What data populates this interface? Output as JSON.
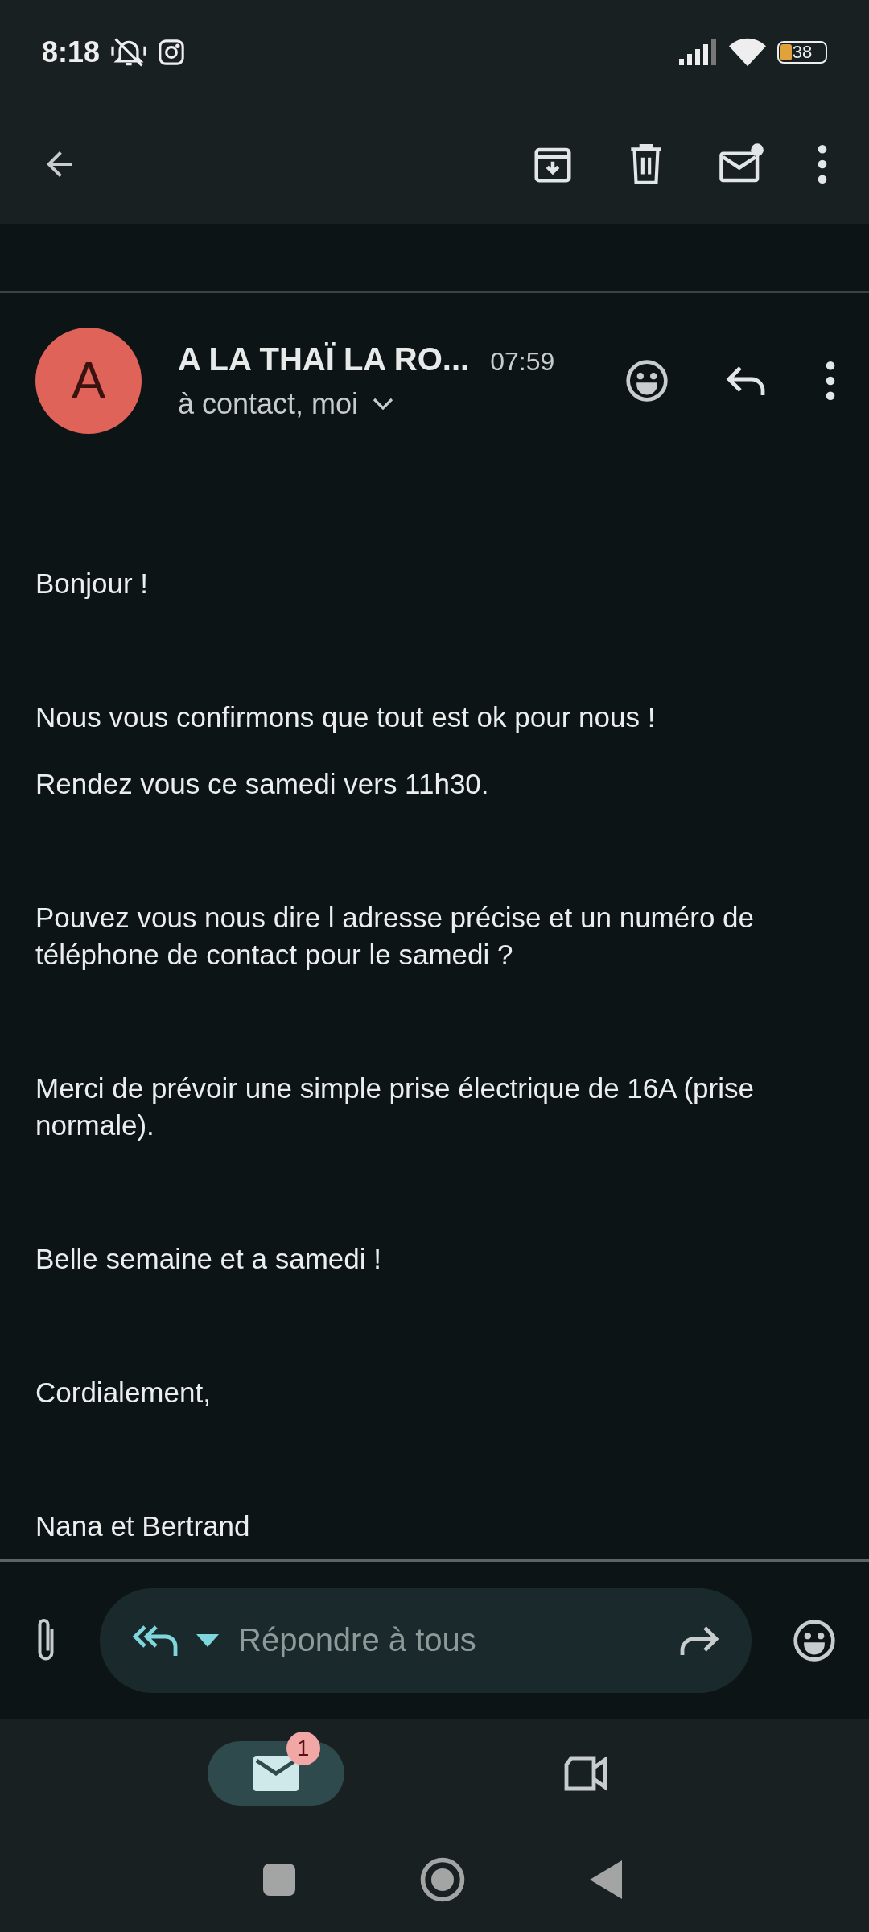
{
  "status_bar": {
    "time": "8:18",
    "battery": "38"
  },
  "sender": {
    "avatar_letter": "A",
    "name": "A LA THAÏ LA RO...",
    "time": "07:59",
    "recipients": "à contact, moi"
  },
  "body": [
    [
      "Bonjour !"
    ],
    [
      "Nous vous confirmons que tout est ok pour nous !",
      "Rendez vous ce samedi vers 11h30."
    ],
    [
      "Pouvez vous nous dire l adresse précise et un numéro de téléphone de contact pour le samedi ?"
    ],
    [
      "Merci de prévoir une simple prise électrique de 16A (prise normale)."
    ],
    [
      "Belle semaine et a samedi !"
    ],
    [
      "Cordialement,"
    ],
    [
      "Nana et Bertrand"
    ]
  ],
  "reply": {
    "placeholder": "Répondre à tous"
  },
  "bottom_nav": [
    {
      "kind": "mail",
      "selected": true,
      "badge": "1"
    },
    {
      "kind": "video",
      "selected": false
    }
  ]
}
